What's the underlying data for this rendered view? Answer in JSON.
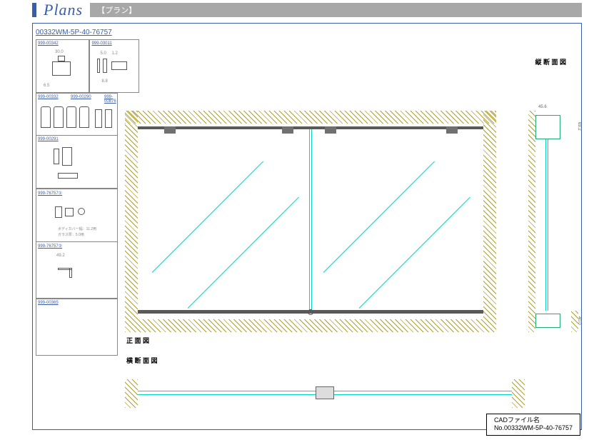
{
  "header": {
    "title": "Plans",
    "tag": "【プラン】"
  },
  "product_code": "00332WM-5P-40-76757",
  "parts": {
    "p1": "999-00342",
    "p2": "999-03011",
    "p3a": "999-00332",
    "p3b": "999-00290",
    "p3c": "999-00876",
    "p4": "999-00291",
    "p5": "999-76757①",
    "p6": "999-76757②",
    "p7": "999-00365"
  },
  "dims": {
    "d1_w": "30.0",
    "d1_h": "6.5",
    "d2_a": "5.0",
    "d2_b": "1.2",
    "d2_c": "8.8",
    "d6_w": "49.2",
    "v_top_w": "45.6",
    "v_top_h": "69.2",
    "v_bot_h": "40.0",
    "d5_note1": "ボディカバー幅：11.2用",
    "d5_note2": "ガラス厚：5.0用"
  },
  "labels": {
    "front": "正 面 図",
    "vsection": "縦 断 面 図",
    "hsection": "横 断 面 図",
    "cad_title": "CADファイル名",
    "cad_no": "No.00332WM-5P-40-76757"
  }
}
